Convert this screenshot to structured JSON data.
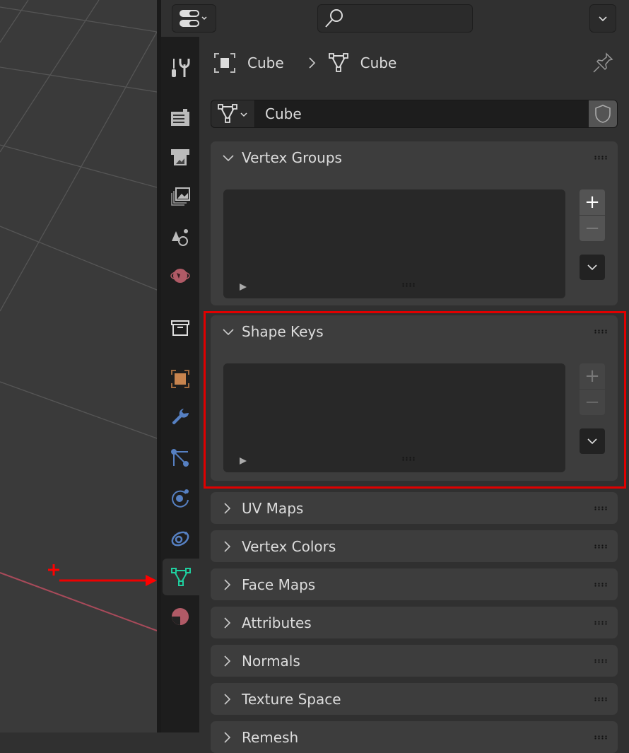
{
  "header": {
    "search_placeholder": "",
    "breadcrumb": {
      "object": "Cube",
      "mesh": "Cube"
    }
  },
  "datablock": {
    "name": "Cube"
  },
  "tabs": [
    {
      "icon": "tool-icon",
      "name": "Tool"
    },
    {
      "icon": "render-icon",
      "name": "Render"
    },
    {
      "icon": "output-icon",
      "name": "Output"
    },
    {
      "icon": "view-layer-icon",
      "name": "View Layer"
    },
    {
      "icon": "scene-icon",
      "name": "Scene"
    },
    {
      "icon": "world-icon",
      "name": "World"
    },
    {
      "icon": "collection-icon",
      "name": "Collection"
    },
    {
      "icon": "object-icon",
      "name": "Object"
    },
    {
      "icon": "modifier-wrench-icon",
      "name": "Modifiers"
    },
    {
      "icon": "particles-icon",
      "name": "Particles"
    },
    {
      "icon": "physics-icon",
      "name": "Physics"
    },
    {
      "icon": "constraints-icon",
      "name": "Constraints"
    },
    {
      "icon": "mesh-data-icon",
      "name": "Data",
      "active": true
    },
    {
      "icon": "material-icon",
      "name": "Material"
    }
  ],
  "panels": {
    "vertex_groups": {
      "title": "Vertex Groups",
      "expanded": true
    },
    "shape_keys": {
      "title": "Shape Keys",
      "expanded": true
    },
    "collapsed": [
      {
        "title": "UV Maps"
      },
      {
        "title": "Vertex Colors"
      },
      {
        "title": "Face Maps"
      },
      {
        "title": "Attributes"
      },
      {
        "title": "Normals"
      },
      {
        "title": "Texture Space"
      },
      {
        "title": "Remesh"
      }
    ]
  },
  "colors": {
    "highlight": "#e00000",
    "active_tab": "#1fcf9f",
    "object_orange": "#c8844e",
    "blue_tabs": "#5680c2",
    "world_red": "#b05a66"
  }
}
